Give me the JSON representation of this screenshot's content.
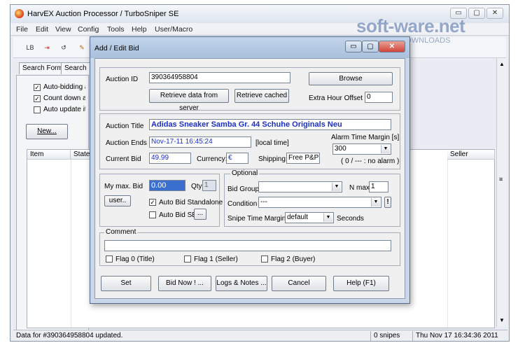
{
  "app": {
    "title": "HarvEX Auction Processor / TurboSniper SE",
    "window_controls": [
      "▭",
      "▢",
      "✕"
    ]
  },
  "watermark": {
    "brand": "soft-ware.net",
    "sub": "AKTUELLE DOWNLOADS"
  },
  "menu": [
    "File",
    "Edit",
    "View",
    "Config",
    "Tools",
    "Help",
    "User/Macro"
  ],
  "toolbar": {
    "btn1": "LB",
    "btn2": "⇥",
    "btn3": "↺",
    "btn4": "✎"
  },
  "left_tabs": [
    "Search Form",
    "Search"
  ],
  "left_panel": {
    "options": [
      {
        "label": "Auto-bidding active",
        "checked": true
      },
      {
        "label": "Count down all items",
        "checked": true
      },
      {
        "label": "Auto update items",
        "checked": false
      }
    ],
    "new_button": "New..."
  },
  "list": {
    "columns": [
      "Item",
      "State",
      "Seller"
    ]
  },
  "status": {
    "message": "Data for #390364958804 updated.",
    "snipes": "0 snipes",
    "time": "Thu Nov 17 16:34:36 2011"
  },
  "dialog": {
    "title": "Add / Edit Bid",
    "auction_id_label": "Auction ID",
    "auction_id": "390364958804",
    "browse": "Browse",
    "retrieve_server": "Retrieve data from server",
    "retrieve_cached": "Retrieve cached",
    "extra_hour_label": "Extra Hour Offset",
    "extra_hour": "0",
    "title_label": "Auction Title",
    "auction_title": "Adidas Sneaker Samba Gr. 44 Schuhe Originals Neu",
    "ends_label": "Auction Ends",
    "ends": "Nov-17-11 16:45:24",
    "local_time": "[local time]",
    "alarm_label": "Alarm Time Margin [s]",
    "alarm_value": "300",
    "alarm_hint": "( 0 / --- : no alarm )",
    "current_bid_label": "Current Bid",
    "current_bid": "49.99",
    "currency_label": "Currency:",
    "currency": "€",
    "shipping_label": "Shipping:",
    "shipping": "Free P&P",
    "max_bid_label": "My max. Bid",
    "max_bid": "0.00",
    "qty_label": "Qty",
    "qty": "1",
    "user_button": "user..",
    "auto_standalone": "Auto Bid Standalone",
    "auto_se": "Auto Bid SE",
    "ellipsis": "...",
    "optional_label": "Optional",
    "bid_group_label": "Bid Group",
    "bid_group": "",
    "n_max_label": "N max",
    "n_max": "1",
    "condition_label": "Condition",
    "condition": "---",
    "exclaim": "!",
    "snipe_margin_label": "Snipe Time Margin",
    "snipe_margin": "default",
    "seconds": "Seconds",
    "comment_label": "Comment",
    "comment": "",
    "flag0": "Flag 0 (Title)",
    "flag1": "Flag 1 (Seller)",
    "flag2": "Flag 2 (Buyer)",
    "set": "Set",
    "bid_now": "Bid Now ! ...",
    "logs": "Logs & Notes ...",
    "cancel": "Cancel",
    "help": "Help (F1)"
  },
  "colors": {
    "title_text": "#1a2fc8",
    "dialog_frame": "#a9c0dc",
    "close_red": "#d2453a"
  }
}
